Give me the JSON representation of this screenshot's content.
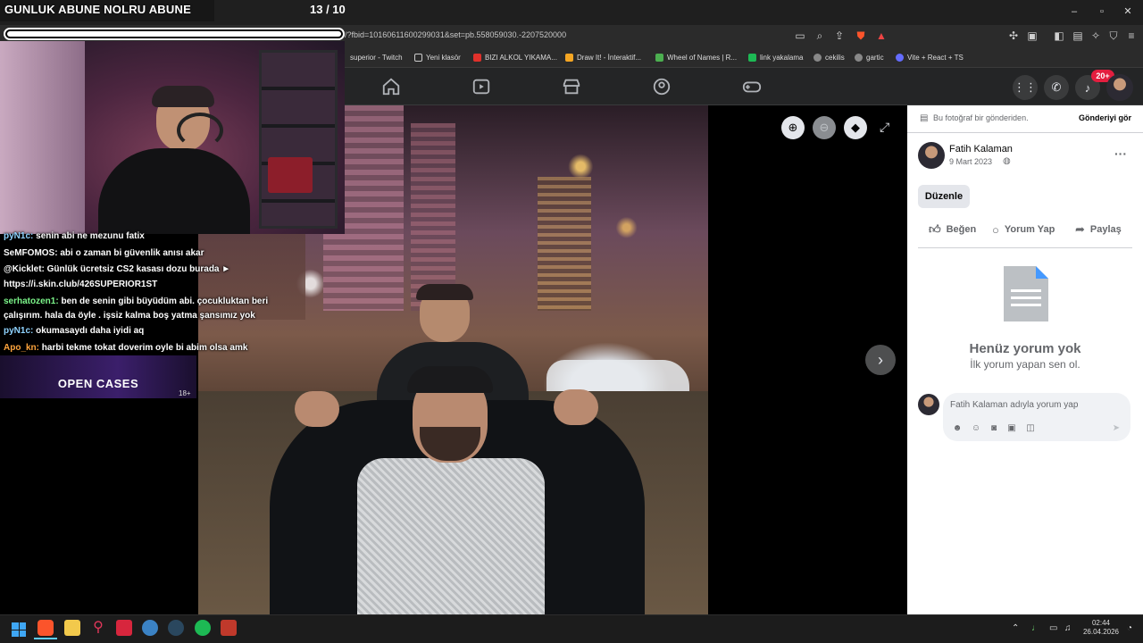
{
  "stream_overlay": {
    "title": "GUNLUK ABUNE NOLRU ABUNE",
    "goal_count": "13 / 10",
    "goal_progress": 1.0
  },
  "browser": {
    "url": "/?fbid=10160611600299031&set=pb.558059030.-2207520000",
    "bookmarks": [
      "superior - Twitch",
      "Yeni klasör",
      "BIZI ALKOL YIKAMA...",
      "Draw It! - İnteraktif...",
      "Wheel of Names | R...",
      "link yakalama",
      "cekilis",
      "gartic",
      "Vite + React + TS"
    ],
    "bookmark_colors": [
      "#9146ff",
      "#cccccc",
      "#e0312b",
      "#f5a623",
      "#4caf50",
      "#1db954",
      "#888888",
      "#888888",
      "#646cff"
    ]
  },
  "fb_nav": {
    "notification_badge": "20+"
  },
  "viewer": {
    "next_icon": "chevron-right-icon"
  },
  "post": {
    "shared_notice": "Bu fotoğraf bir gönderiden.",
    "view_post": "Gönderiyi gör",
    "author": "Fatih Kalaman",
    "date": "9 Mart 2023",
    "more": "···",
    "edit_button": "Düzenle",
    "actions": {
      "like": "Beğen",
      "comment": "Yorum Yap",
      "share": "Paylaş"
    },
    "no_comments_title": "Henüz yorum yok",
    "no_comments_sub": "İlk yorum yapan sen ol.",
    "comment_placeholder": "Fatih Kalaman adıyla yorum yap"
  },
  "chat": {
    "messages": [
      {
        "user": "pyN1c:",
        "text": "senin abi ne mezunu fatix",
        "color": "#8fd3ff"
      },
      {
        "user": "SeMFOMOS:",
        "text": "abi o zaman bi güvenlik anısı akar",
        "color": "#ffffff"
      },
      {
        "user": "@Kicklet:",
        "text": "Günlük ücretsiz CS2 kasası dozu burada ►",
        "color": "#ffffff"
      },
      {
        "user": "",
        "text": "https://i.skin.club/426SUPERIOR1ST",
        "color": "#ffffff"
      },
      {
        "user": "serhatozen1:",
        "text": "ben de senin gibi büyüdüm abi. çocukluktan beri",
        "color": "#7cf58a"
      },
      {
        "user": "",
        "text": "çalışırım. hala da öyle . işsiz kalma boş yatma şansımız yok",
        "color": "#ffffff"
      },
      {
        "user": "pyN1c:",
        "text": "okumasaydı daha iyidi aq",
        "color": "#8fd3ff"
      },
      {
        "user": "Apo_kn:",
        "text": "harbi tekme tokat doverim oyle bi abim olsa amk",
        "color": "#ffa53d"
      }
    ]
  },
  "ad": {
    "text": "OPEN CASES",
    "age": "18+"
  },
  "taskbar": {
    "time": "02:44",
    "date": "26.04.2026"
  }
}
